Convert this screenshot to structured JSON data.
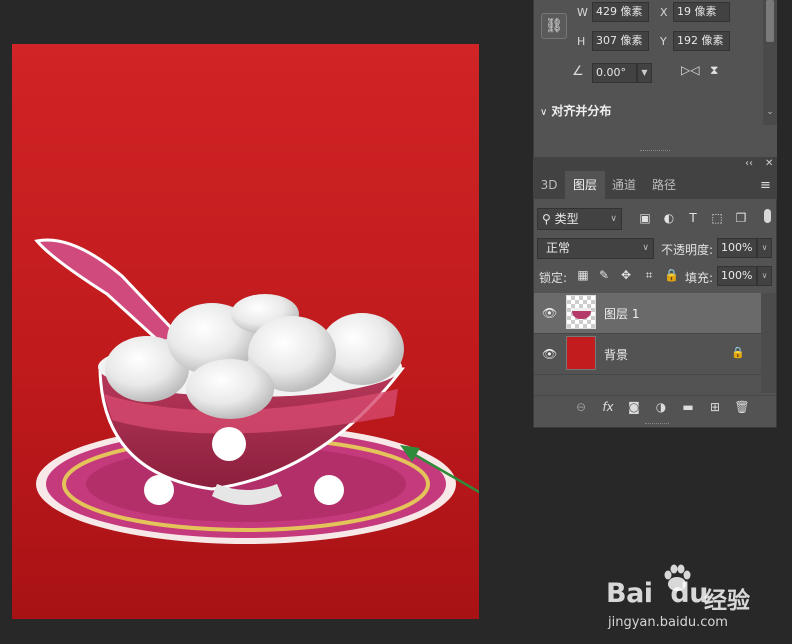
{
  "properties": {
    "link_icon": "chain-link-icon",
    "width_label": "W",
    "width_value": "429 像素",
    "x_label": "X",
    "x_value": "19 像素",
    "height_label": "H",
    "height_value": "307 像素",
    "y_label": "Y",
    "y_value": "192 像素",
    "angle_value": "0.00°",
    "align_section_title": "对齐并分布"
  },
  "layers_panel": {
    "tabs": [
      {
        "label": "3D",
        "active": false
      },
      {
        "label": "图层",
        "active": true
      },
      {
        "label": "通道",
        "active": false
      },
      {
        "label": "路径",
        "active": false
      }
    ],
    "filter_type": "类型",
    "blend_mode": "正常",
    "opacity_label": "不透明度:",
    "opacity_value": "100%",
    "lock_label": "锁定:",
    "fill_label": "填充:",
    "fill_value": "100%",
    "layers": [
      {
        "name": "图层 1",
        "selected": true,
        "visible": true,
        "locked": false
      },
      {
        "name": "背景",
        "selected": false,
        "visible": true,
        "locked": true
      }
    ]
  },
  "canvas": {
    "background_color": "#c41e20",
    "annotation_arrow_color": "#2e8b3a"
  },
  "watermark": {
    "brand": "Bai",
    "brand_suffix": "du",
    "cn_text": "经验",
    "url": "jingyan.baidu.com"
  }
}
